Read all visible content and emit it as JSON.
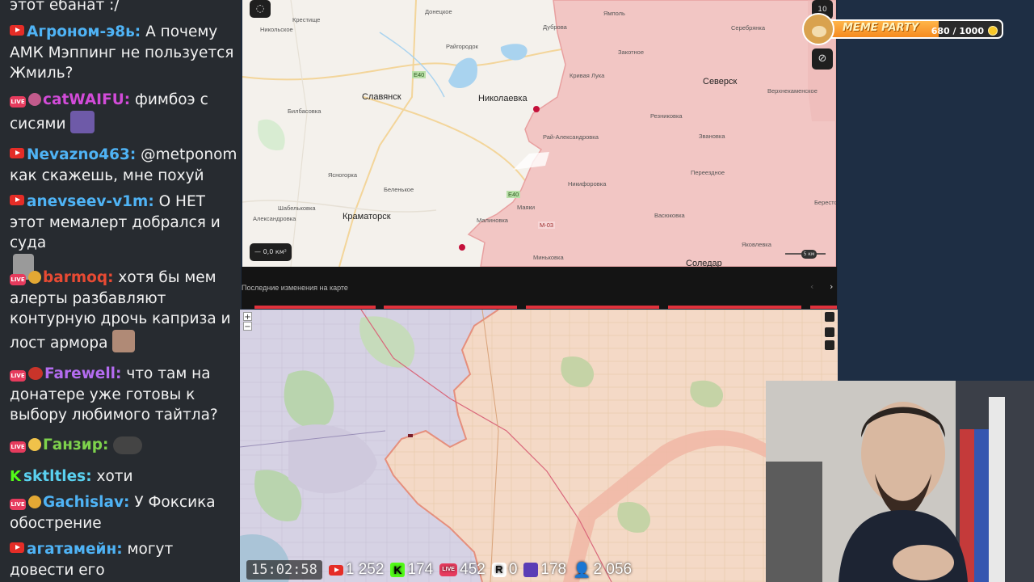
{
  "chat": {
    "messages": [
      {
        "platform": "none",
        "author": "",
        "text": "этот ебанат :/"
      },
      {
        "platform": "youtube",
        "author": "Агроном-э8ь:",
        "author_color": "#4fb3f5",
        "text": "А почему АМК Мэппинг не пользуется Жмиль?"
      },
      {
        "platform": "vk",
        "author": "catWAIFU:",
        "author_color": "#d24bd8",
        "text": "фимбоэ с сисями"
      },
      {
        "platform": "youtube",
        "author": "Nevazno463:",
        "author_color": "#4fb3f5",
        "text": "@metponom как скажешь, мне похуй"
      },
      {
        "platform": "youtube",
        "author": "anevseev-v1m:",
        "author_color": "#4fb3f5",
        "text": "О НЕТ этот мемалерт добрался и суда"
      },
      {
        "platform": "vk",
        "author": "barmoq:",
        "author_color": "#e84a33",
        "text": "хотя бы мем алерты разбавляют контурную дрочь каприза и лост армора"
      },
      {
        "platform": "vk",
        "author": "Farewell:",
        "author_color": "#b46cf0",
        "text": "что там на донатере уже готовы к выбору любимого тайтла?"
      },
      {
        "platform": "vk",
        "author": "Ганзир:",
        "author_color": "#7ed24c",
        "text": ""
      },
      {
        "platform": "kick",
        "author": "sktltles:",
        "author_color": "#5ad1f0",
        "text": "хоти"
      },
      {
        "platform": "vk",
        "author": "Gachislav:",
        "author_color": "#4fb3f5",
        "text": "У Фоксика обострение"
      },
      {
        "platform": "youtube",
        "author": "агатамейн:",
        "author_color": "#4fb3f5",
        "text": "могут довести его"
      }
    ]
  },
  "top_map": {
    "cities": [
      "Славянск",
      "Николаевка",
      "Краматорск",
      "Северск",
      "Соледар"
    ],
    "villages": [
      "Крестище",
      "Донецкое",
      "Никольское",
      "Райгородок",
      "Дуброва",
      "Ямполь",
      "Серебрянка",
      "Закотное",
      "Кривая Лука",
      "Билбасовка",
      "Резниковка",
      "Верхнекаменское",
      "Рай-Александровка",
      "Звановка",
      "Ясногорка",
      "Беленькое",
      "Никифоровка",
      "Переездное",
      "Шабельковка",
      "Александровка",
      "Маяки",
      "Малиновка",
      "Васюковка",
      "Берестовое",
      "Миньковка",
      "Яковлевка"
    ],
    "roads": [
      "E40",
      "E40",
      "M-03"
    ],
    "scale_label": "5 км",
    "area_label": "0,0 км²",
    "zoom_level": "10",
    "recent_changes_label": "Последние изменения на карте"
  },
  "meme_party": {
    "title": "MEME PARTY",
    "score": "680 / 1000",
    "progress": 0.68
  },
  "stats": {
    "clock": "15:02:58",
    "youtube": "1 252",
    "kick": "174",
    "vk": "452",
    "rutube": "0",
    "trovo": "178",
    "viewers": "2 056"
  },
  "colors": {
    "occupied": "#f2c6c4",
    "occupied_line": "#e8a0a0",
    "occupied_bottom": "#f6d9c4",
    "chat_bg": "#272b30"
  }
}
